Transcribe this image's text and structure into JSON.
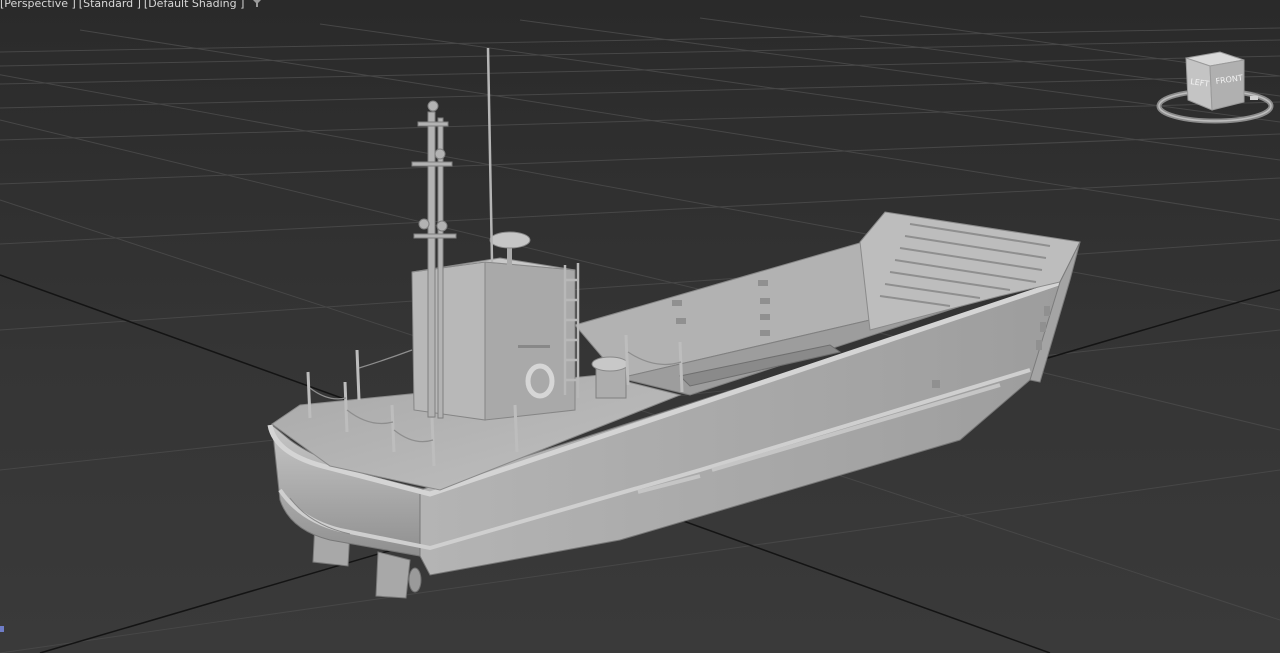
{
  "viewport": {
    "label_parts": [
      "[Perspective ]",
      "[Standard ]",
      "[Default Shading ]"
    ],
    "view_type": "perspective",
    "shading": "default",
    "background_color": "#2e2e2e",
    "grid_color": "#4a4a4a",
    "model_color": "#b9b9b9"
  },
  "viewcube": {
    "face_left": "LEFT",
    "face_front": "FRONT"
  },
  "model": {
    "type": "landing craft",
    "icon_name": "boat-model"
  },
  "icons": {
    "filter": "filter-icon",
    "viewcube": "viewcube-icon",
    "axis": "axis-indicator-icon"
  }
}
